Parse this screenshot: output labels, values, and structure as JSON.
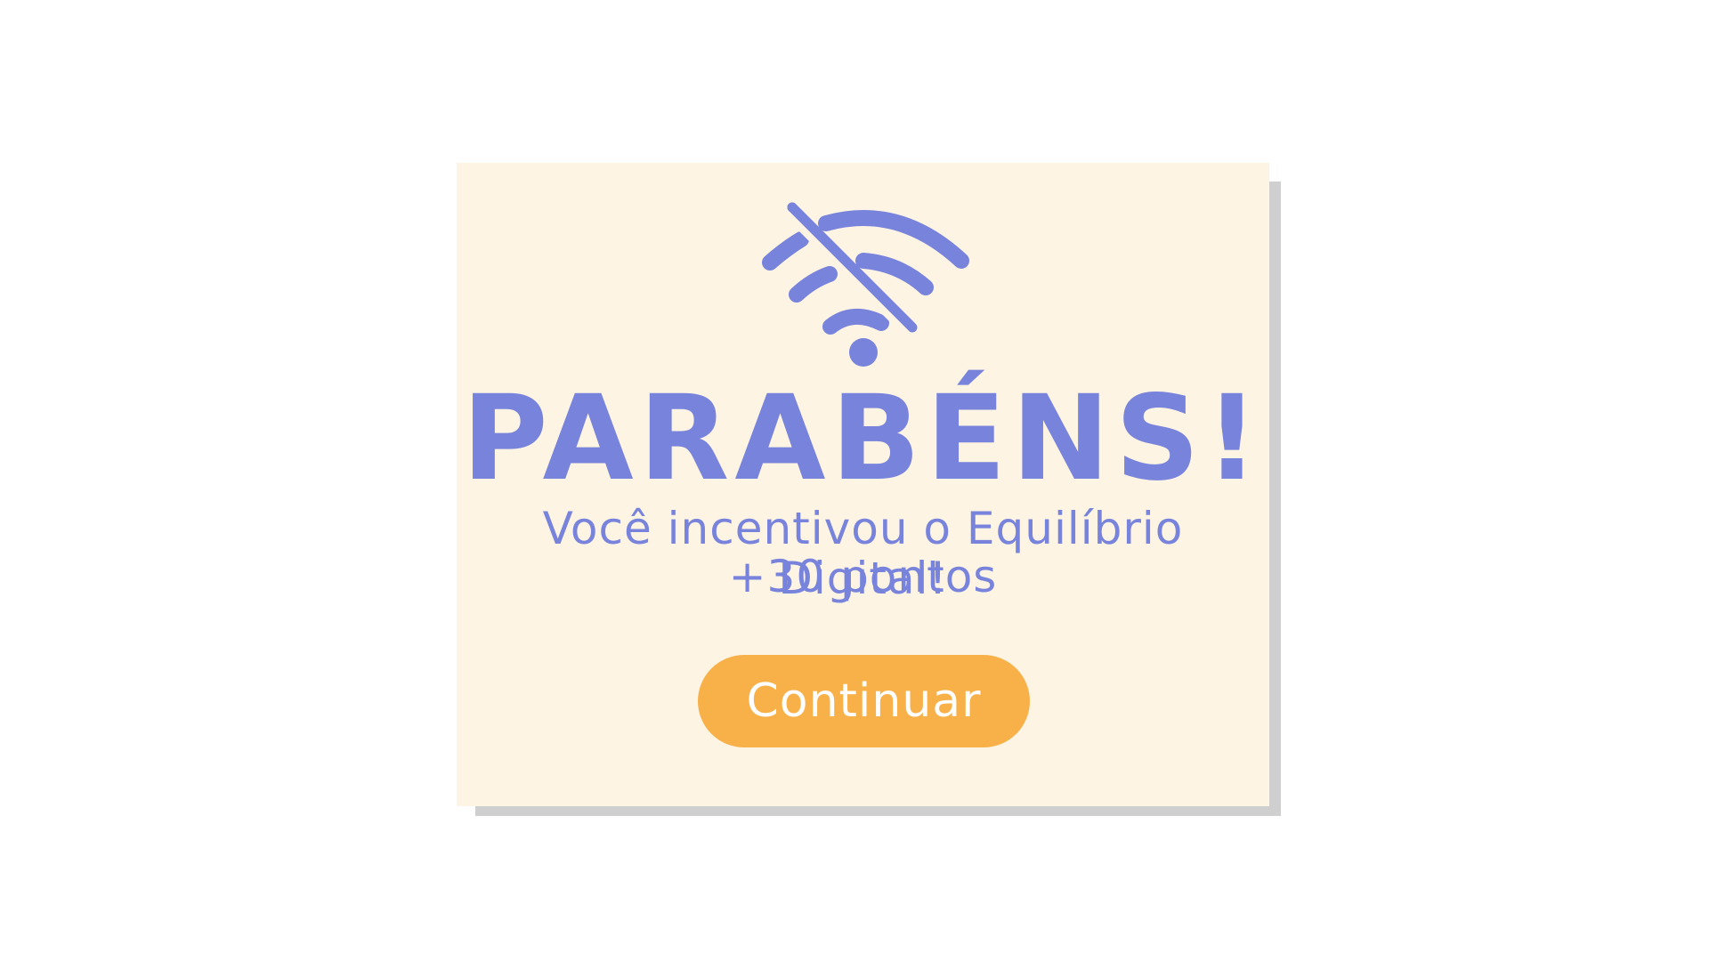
{
  "dialog": {
    "title": "PARABÉNS!",
    "message": "Você incentivou o Equilíbrio Digital!",
    "points": "+30 pontos",
    "continue_label": "Continuar",
    "icon": "wifi-off-icon"
  },
  "colors": {
    "background": "#ffffff",
    "card": "#fef4e4",
    "card_shadow": "#cfcfcf",
    "accent_purple": "#7883dc",
    "button": "#f8b049",
    "button_text": "#ffffff"
  }
}
